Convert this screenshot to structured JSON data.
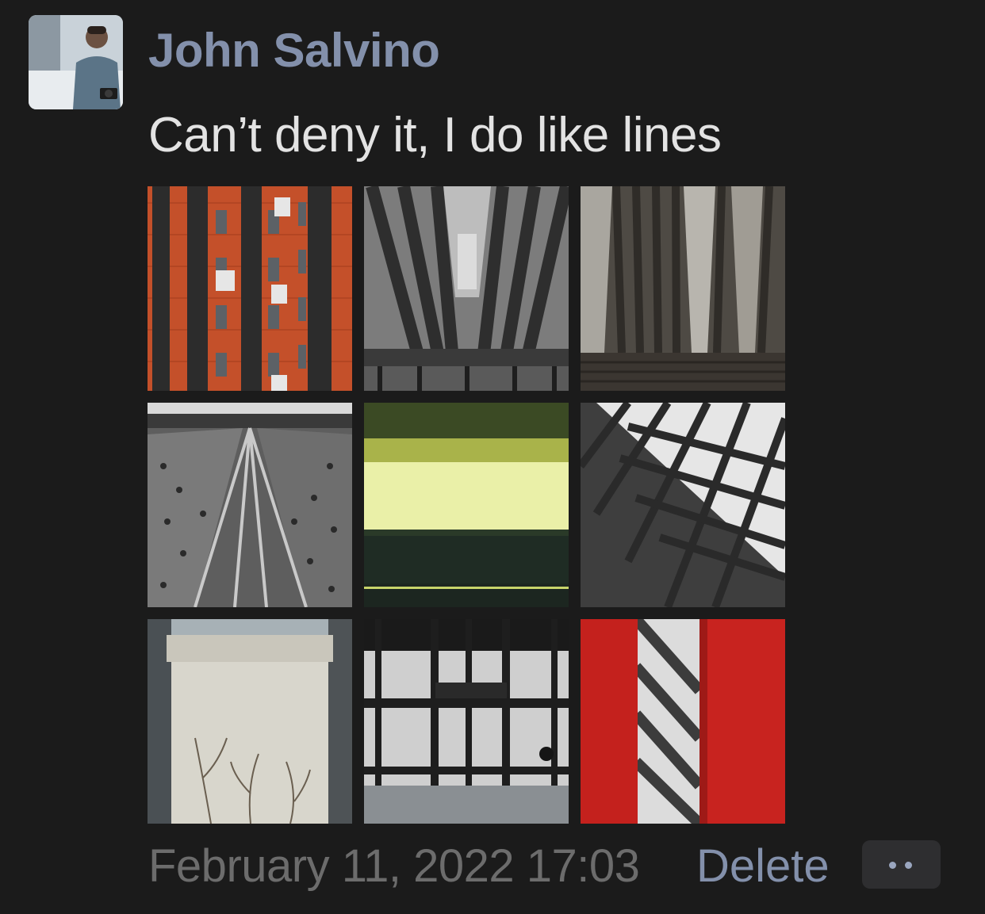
{
  "post": {
    "author": "John Salvino",
    "message": "Can’t deny it, I do like lines",
    "timestamp": "February 11, 2022 17:03",
    "delete_label": "Delete",
    "more_icon": "more-dots-icon"
  },
  "colors": {
    "background": "#1b1b1b",
    "author": "#8390ab",
    "message": "#e3e3e3",
    "timestamp": "#6c6c6c",
    "link": "#8390ab",
    "button_bg": "#2e2e30"
  },
  "gallery": {
    "photos": [
      {
        "name": "photo-red-brick-building"
      },
      {
        "name": "photo-looking-up-balconies"
      },
      {
        "name": "photo-metal-panels"
      },
      {
        "name": "photo-perforated-ceiling"
      },
      {
        "name": "photo-yellow-light-window"
      },
      {
        "name": "photo-grid-roof"
      },
      {
        "name": "photo-wall-with-vines"
      },
      {
        "name": "photo-glass-ceiling"
      },
      {
        "name": "photo-red-pillars"
      }
    ]
  }
}
